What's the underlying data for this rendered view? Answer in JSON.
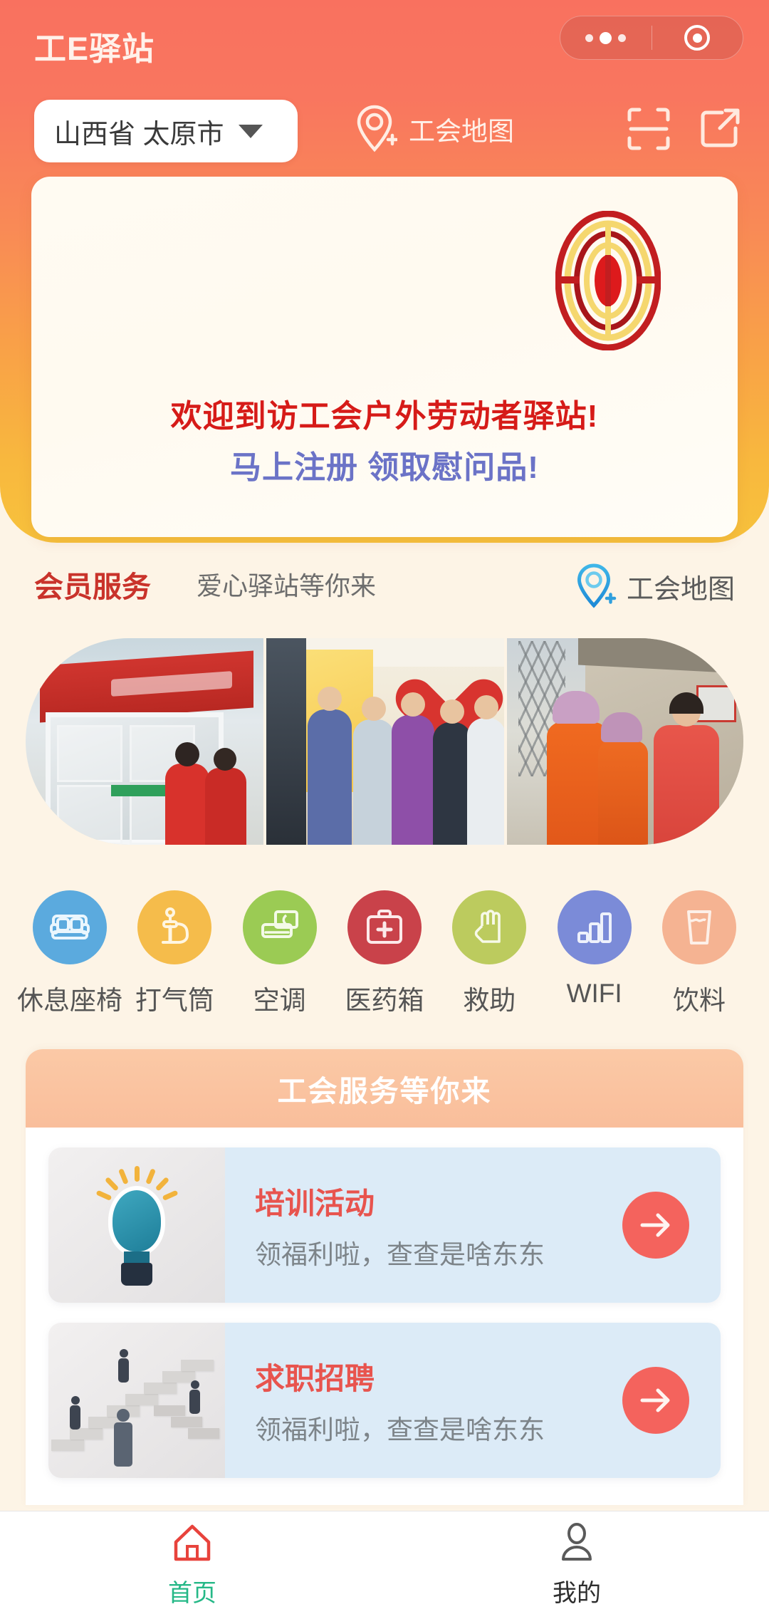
{
  "header": {
    "app_title": "工E驿站",
    "capsule": {
      "menu_icon": "more-dots-icon",
      "close_icon": "target-circle-icon"
    }
  },
  "location_bar": {
    "selected_location": "山西省 太原市",
    "dropdown_icon": "chevron-down-icon",
    "map_link_label": "工会地图",
    "map_pin_icon": "map-pin-add-icon",
    "scan_icon": "scan-qr-icon",
    "share_icon": "share-icon"
  },
  "banner": {
    "logo_icon": "acftu-union-emblem-icon",
    "welcome_line_1": "欢迎到访工会户外劳动者驿站!",
    "welcome_line_2": "马上注册 领取慰问品!",
    "welcome_color_1": "#D61B18",
    "welcome_color_2": "#6B73C7"
  },
  "member_services": {
    "title": "会员服务",
    "subtitle": "爱心驿站等你来",
    "map_label": "工会地图",
    "map_pin_icon": "map-pin-add-icon",
    "title_color": "#C9332B"
  },
  "gallery": {
    "photos": [
      {
        "alt": "爱心驿站门店照片"
      },
      {
        "alt": "爱心驿站室内参观照片"
      },
      {
        "alt": "户外劳动者与工作人员合影"
      }
    ]
  },
  "service_icons": [
    {
      "label": "休息座椅",
      "icon": "sofa-icon",
      "color": "#5BAADE"
    },
    {
      "label": "打气筒",
      "icon": "air-pump-icon",
      "color": "#F5BC4B"
    },
    {
      "label": "空调",
      "icon": "air-conditioner-icon",
      "color": "#9BCB54"
    },
    {
      "label": "医药箱",
      "icon": "first-aid-kit-icon",
      "color": "#C9424A"
    },
    {
      "label": "救助",
      "icon": "helping-hand-icon",
      "color": "#BCCB5E"
    },
    {
      "label": "WIFI",
      "icon": "wifi-bars-icon",
      "color": "#7B8BD8"
    },
    {
      "label": "饮料",
      "icon": "drink-cup-icon",
      "color": "#F5B392"
    }
  ],
  "union_services": {
    "panel_title": "工会服务等你来",
    "cards": [
      {
        "title": "培训活动",
        "subtitle": "领福利啦，查查是啥东东",
        "image_icon": "lightbulb-illustration",
        "arrow_icon": "arrow-right-icon"
      },
      {
        "title": "求职招聘",
        "subtitle": "领福利啦，查查是啥东东",
        "image_icon": "career-stairs-illustration",
        "arrow_icon": "arrow-right-icon"
      }
    ]
  },
  "tabbar": {
    "tabs": [
      {
        "label": "首页",
        "icon": "home-icon",
        "active": true
      },
      {
        "label": "我的",
        "icon": "person-icon",
        "active": false
      }
    ]
  },
  "theme": {
    "hero_top": "#F9715F",
    "hero_bottom": "#F7C23C",
    "page_bg": "#FDF4E6",
    "card_blue": "#DCEBF7",
    "accent_red": "#F4635D",
    "panel_head": "#FBC9A6",
    "tab_active": "#25B887"
  }
}
